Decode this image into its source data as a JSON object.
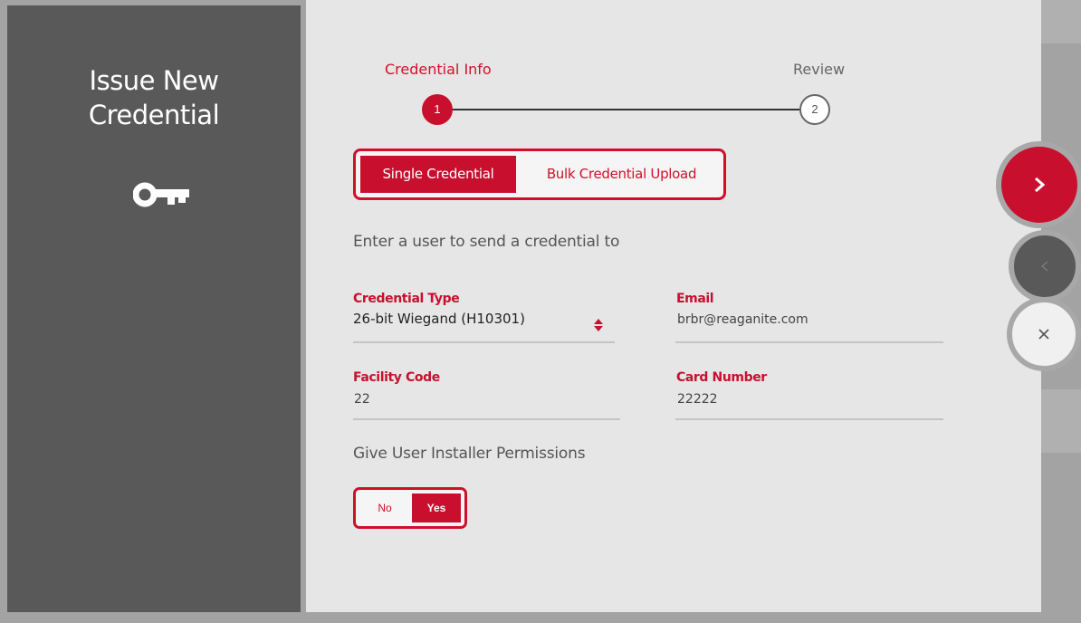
{
  "sidebar": {
    "title_line1": "Issue New",
    "title_line2": "Credential",
    "icon": "key-icon"
  },
  "stepper": {
    "steps": [
      {
        "label": "Credential Info",
        "number": "1",
        "state": "active"
      },
      {
        "label": "Review",
        "number": "2",
        "state": "inactive"
      }
    ]
  },
  "mode_toggle": {
    "options": [
      "Single Credential",
      "Bulk Credential Upload"
    ],
    "selected": "Single Credential"
  },
  "form": {
    "intro": "Enter a user to send a credential to",
    "credential_type": {
      "label": "Credential Type",
      "value": "26-bit Wiegand (H10301)"
    },
    "email": {
      "label": "Email",
      "value": "brbr@reaganite.com"
    },
    "facility_code": {
      "label": "Facility Code",
      "value": "22"
    },
    "card_number": {
      "label": "Card Number",
      "value": "22222"
    },
    "installer_permissions": {
      "label": "Give User Installer Permissions",
      "options": [
        "No",
        "Yes"
      ],
      "selected": "Yes"
    }
  },
  "actions": {
    "next_icon": "chevron-right-icon",
    "back_icon": "chevron-left-icon",
    "close_icon": "close-icon"
  },
  "colors": {
    "accent": "#c8102e",
    "sidebar": "#595959",
    "panel": "#e6e6e6"
  }
}
